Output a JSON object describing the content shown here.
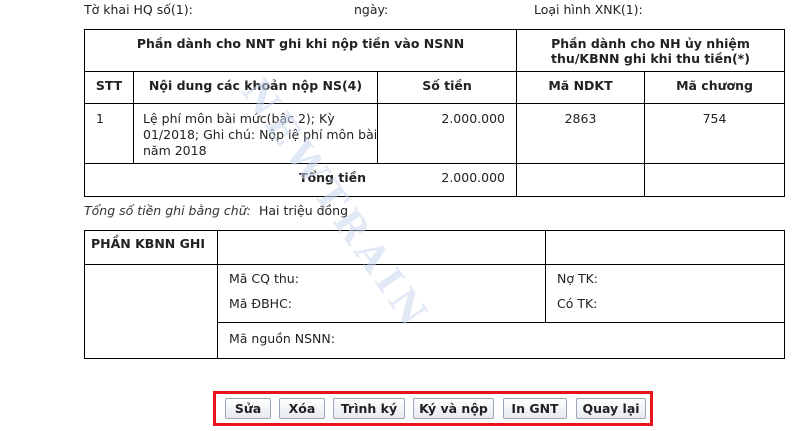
{
  "header": {
    "to_khai": "Tờ khai HQ số(1):",
    "ngay": "ngày:",
    "loai_hinh": "Loại hình XNK(1):"
  },
  "table": {
    "nnt_header": "Phần dành cho NNT ghi khi nộp tiền vào NSNN",
    "kbnn_header_line1": "Phần dành cho NH ủy nhiệm",
    "kbnn_header_line2": "thu/KBNN ghi khi thu tiền(*)",
    "col_stt": "STT",
    "col_noidung": "Nội dung các khoản nộp NS(4)",
    "col_sotien": "Số tiền",
    "col_mandkt": "Mã NDKT",
    "col_machuong": "Mã chương",
    "row": {
      "stt": "1",
      "noidung_line1": "Lệ phí môn bài mức(bậc 2); Kỳ",
      "noidung_line2": "01/2018; Ghi chú: Nộp lệ phí môn bài",
      "noidung_line3": "năm 2018",
      "sotien": "2.000.000",
      "mandkt": "2863",
      "machuong": "754"
    },
    "tong_tien_label": "Tổng tiền",
    "tong_tien_value": "2.000.000"
  },
  "amount_words": {
    "label": "Tổng số tiền ghi bằng chữ:",
    "value": "Hai triệu đồng"
  },
  "kbnn": {
    "title": "PHẦN KBNN GHI",
    "ma_cq_thu": "Mã CQ thu:",
    "no_tk": "Nợ TK:",
    "ma_dbhc": "Mã ĐBHC:",
    "co_tk": "Có TK:",
    "ma_nguon": "Mã nguồn NSNN:"
  },
  "buttons": {
    "sua": "Sửa",
    "xoa": "Xóa",
    "trinh_ky": "Trình ký",
    "ky_va_nop": "Ký và nộp",
    "in_gnt": "In GNT",
    "quay_lai": "Quay lại"
  },
  "watermark": "NEWTRAIN",
  "colors": {
    "highlight_border": "#e8141b"
  }
}
